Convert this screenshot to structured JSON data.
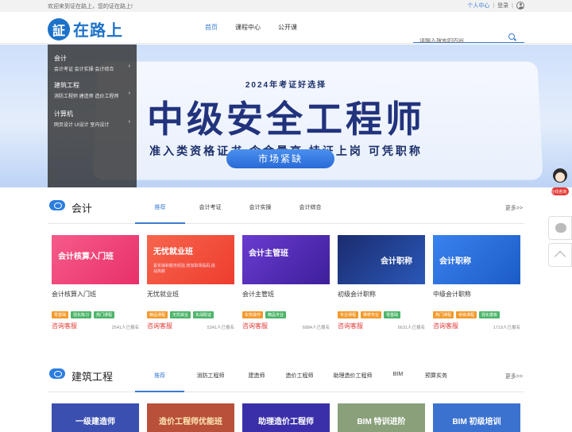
{
  "topbar": {
    "welcome": "欢迎来到证在路上，您的证在路上!",
    "user_center": "个人中心",
    "separator": "|",
    "login": "登录"
  },
  "logo": {
    "mark": "証",
    "text": "在路上"
  },
  "nav": [
    {
      "label": "首页",
      "active": true
    },
    {
      "label": "课程中心"
    },
    {
      "label": "公开课"
    }
  ],
  "search": {
    "placeholder": "请输入搜索的内容"
  },
  "side_menu": [
    {
      "title": "会计",
      "subs": "会计考证   会计实操   会计综合"
    },
    {
      "title": "建筑工程",
      "subs": "消防工程师   建造师   造价工程师"
    },
    {
      "title": "计算机",
      "subs": "网页设计   UI设计   室内设计"
    }
  ],
  "banner": {
    "year_line": "2024年考证好选择",
    "main": "中级安全工程师",
    "sub": "准入类资格证书  含金量高  持证上岗  可凭职称",
    "button": "市场紧缺"
  },
  "section1": {
    "title": "会计",
    "tabs": [
      "推荐",
      "会计考证",
      "会计实操",
      "会计综合"
    ],
    "more": "更多>>",
    "cards": [
      {
        "thumb_text": "会计核算入门班",
        "name": "会计核算入门班",
        "tags": [
          "零基础",
          "强化练习",
          "热门课程"
        ],
        "consult": "咨询客服",
        "enrolled": "2541人已报名",
        "color": "#f03c73"
      },
      {
        "thumb_text": "无忧就业班",
        "thumb_sub": "紧实操和税务经验,增加职场砝码,挑战高薪",
        "name": "无忧就业班",
        "tags": [
          "精品课程",
          "无忧就业",
          "实战取证"
        ],
        "consult": "咨询客服",
        "enrolled": "5341人已报名",
        "color": "#f2543f"
      },
      {
        "thumb_text": "会计主管班",
        "name": "会计主管班",
        "tags": [
          "实务操作",
          "精品专业"
        ],
        "consult": "咨询客服",
        "enrolled": "6884人已报名",
        "color": "#5a2fb8"
      },
      {
        "thumb_text": "会计职称",
        "name": "初级会计职称",
        "tags": [
          "专业课程",
          "推荐专业",
          "零基础"
        ],
        "consult": "咨询客服",
        "enrolled": "6631人已报名",
        "color": "#1a3d8f"
      },
      {
        "thumb_text": "会计职称",
        "name": "中级会计职称",
        "tags": [
          "热门课程",
          "考级课程",
          "强化模板"
        ],
        "consult": "咨询客服",
        "enrolled": "1719人已报名",
        "color": "#2c6fe0"
      }
    ]
  },
  "section2": {
    "title": "建筑工程",
    "tabs": [
      "推荐",
      "消防工程师",
      "建造师",
      "造价工程师",
      "助理造价工程师",
      "BIM",
      "预算实务"
    ],
    "more": "更多>>",
    "cards": [
      {
        "thumb_text": "一级建造师",
        "color": "#3a4fb0"
      },
      {
        "thumb_text": "造价工程师优能班",
        "color": "#b8503a"
      },
      {
        "thumb_text": "助理造价工程师",
        "color": "#3a2fa8"
      },
      {
        "thumb_text": "BIM 特训进阶",
        "color": "#8aa07a"
      },
      {
        "thumb_text": "BIM 初级培训",
        "color": "#3c72cf"
      }
    ]
  },
  "float": {
    "consult_label": "在线咨询"
  }
}
